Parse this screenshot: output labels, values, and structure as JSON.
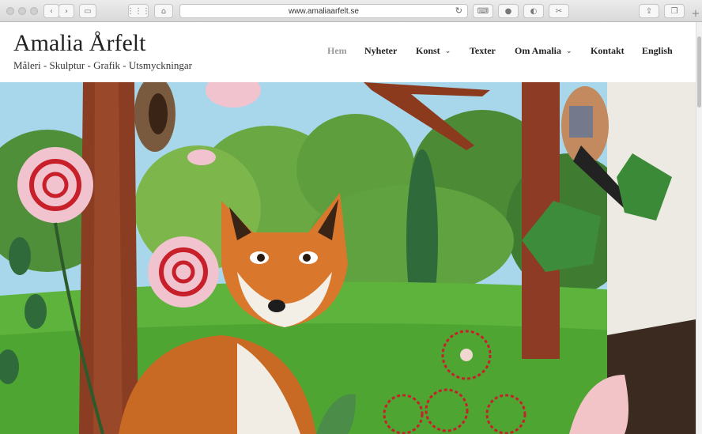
{
  "browser": {
    "url": "www.amaliaarfelt.se"
  },
  "site": {
    "title": "Amalia Årfelt",
    "tagline": "Måleri - Skulptur - Grafik - Utsmyckningar"
  },
  "nav": [
    {
      "label": "Hem",
      "active": true
    },
    {
      "label": "Nyheter"
    },
    {
      "label": "Konst",
      "dropdown": true
    },
    {
      "label": "Texter"
    },
    {
      "label": "Om Amalia",
      "dropdown": true
    },
    {
      "label": "Kontakt"
    },
    {
      "label": "English"
    }
  ],
  "colors": {
    "nav_active": "#9a9a9a",
    "text": "#222222",
    "sky": "#9fd0e6",
    "grass": "#5bb13a",
    "fox": "#d9782c",
    "rose": "#c8202a"
  }
}
